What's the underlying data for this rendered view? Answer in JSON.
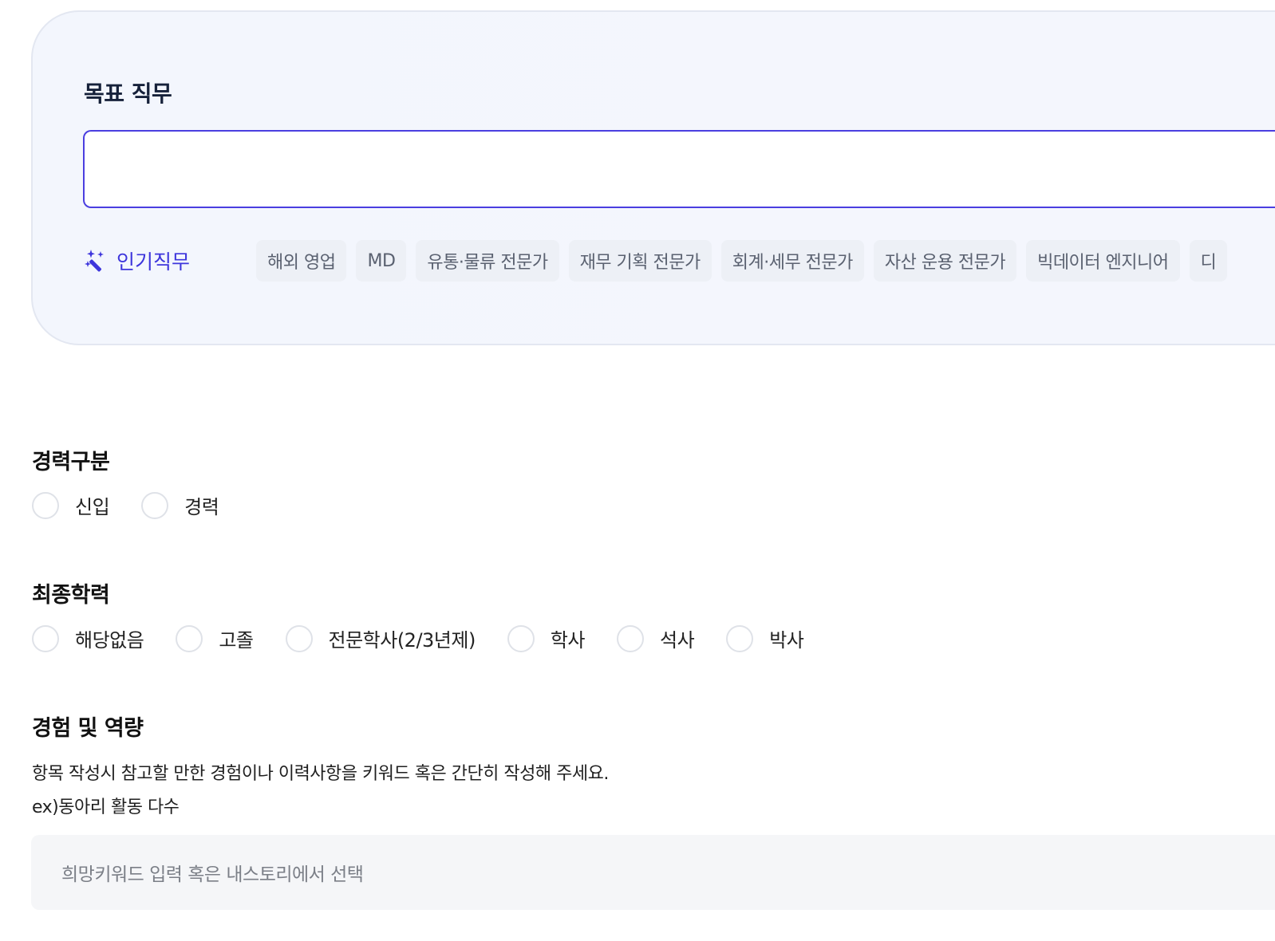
{
  "target_job": {
    "title": "목표 직무",
    "input_value": "",
    "popular_label": "인기직무",
    "popular_icon": "magic-wand-icon",
    "chips": [
      "해외 영업",
      "MD",
      "유통·물류 전문가",
      "재무 기획 전문가",
      "회계·세무 전문가",
      "자산 운용 전문가",
      "빅데이터 엔지니어",
      "디"
    ]
  },
  "career": {
    "title": "경력구분",
    "options": [
      "신입",
      "경력"
    ]
  },
  "education": {
    "title": "최종학력",
    "options": [
      "해당없음",
      "고졸",
      "전문학사(2/3년제)",
      "학사",
      "석사",
      "박사"
    ]
  },
  "experience": {
    "title": "경험 및 역량",
    "description_line1": "항목 작성시 참고할 만한 경험이나 이력사항을 키워드 혹은 간단히 작성해 주세요.",
    "description_line2": "ex)동아리 활동 다수",
    "keyword_placeholder": "희망키워드 입력 혹은 내스토리에서 선택"
  },
  "colors": {
    "accent": "#3d35dc",
    "input_border": "#4a3ee0",
    "card_background": "#f3f6fd",
    "chip_background": "#edf0f6"
  }
}
